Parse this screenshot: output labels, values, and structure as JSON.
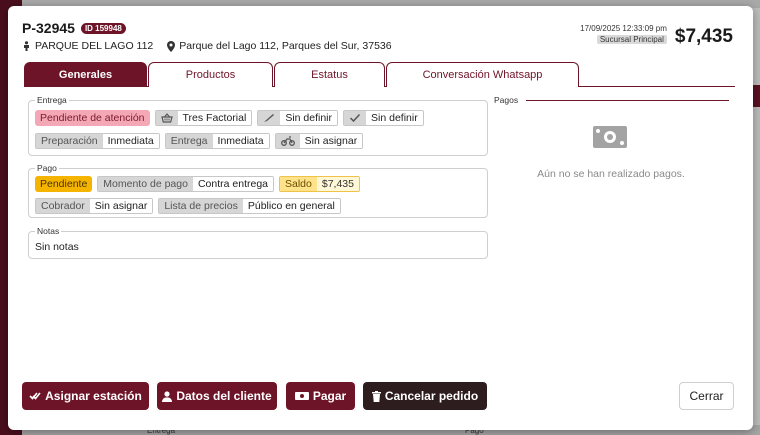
{
  "order": {
    "code": "P-32945",
    "id_badge": "ID 159948",
    "place": "PARQUE DEL LAGO 112",
    "address": "Parque del Lago 112, Parques del Sur, 37536",
    "datetime": "17/09/2025 12:33:09 pm",
    "branch": "Sucursal Principal",
    "total": "$7,435"
  },
  "tabs": [
    {
      "label": "Generales"
    },
    {
      "label": "Productos"
    },
    {
      "label": "Estatus"
    },
    {
      "label": "Conversación Whatsapp"
    }
  ],
  "entrega": {
    "legend": "Entrega",
    "status": "Pendiente de atención",
    "station": "Tres Factorial",
    "field2": "Sin definir",
    "field3": "Sin definir",
    "prep_label": "Preparación",
    "prep_value": "Inmediata",
    "delivery_label": "Entrega",
    "delivery_value": "Inmediata",
    "driver": "Sin asignar"
  },
  "pago": {
    "legend": "Pago",
    "status": "Pendiente",
    "moment_label": "Momento de pago",
    "moment_value": "Contra entrega",
    "balance_label": "Saldo",
    "balance_value": "$7,435",
    "collector_label": "Cobrador",
    "collector_value": "Sin asignar",
    "pricelist_label": "Lista de precios",
    "pricelist_value": "Público en general"
  },
  "notas": {
    "legend": "Notas",
    "text": "Sin notas"
  },
  "pagos": {
    "legend": "Pagos",
    "empty": "Aún no se han realizado pagos."
  },
  "actions": {
    "assign": "Asignar estación",
    "client": "Datos del cliente",
    "pay": "Pagar",
    "cancel": "Cancelar pedido",
    "close": "Cerrar"
  },
  "background": {
    "bottom_left": "Entrega",
    "bottom_right": "Pago"
  },
  "colors": {
    "brand": "#6e1428",
    "dark_button": "#2e1d1f",
    "pending_red": "#f4a7b4",
    "pending_yellow": "#f5b400"
  }
}
